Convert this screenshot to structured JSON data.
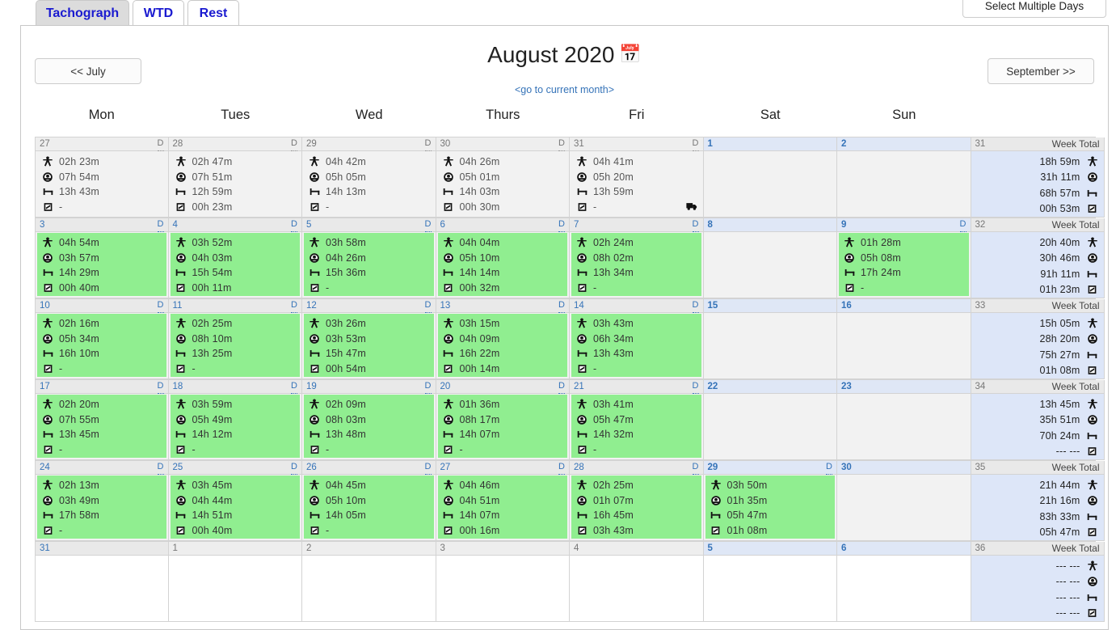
{
  "tabs": [
    {
      "label": "Tachograph",
      "active": true
    },
    {
      "label": "WTD",
      "active": false
    },
    {
      "label": "Rest",
      "active": false
    }
  ],
  "toolbar": {
    "select_multiple_days_label": "Select Multiple Days"
  },
  "header": {
    "month_title": "August 2020",
    "calendar_glyph": "📅",
    "prev_month_label": "<< July",
    "next_month_label": "September >>",
    "current_month_link": "<go to current month>"
  },
  "calendar": {
    "day_headers": [
      "Mon",
      "Tues",
      "Wed",
      "Thurs",
      "Fri",
      "Sat",
      "Sun"
    ],
    "week_total_header": "Week Total",
    "day_flag_label": "D",
    "empty_value": "-",
    "no_value": "--- ---",
    "metric_icons": [
      "work-icon",
      "drive-icon",
      "rest-icon",
      "poa-icon"
    ],
    "colors": {
      "green_day": "#90ee90",
      "weekend_header": "#dfe7f6",
      "week_total_body": "#dde6f8",
      "link": "#3573b8",
      "tab_text": "#1a1ad0"
    },
    "weeks": [
      {
        "week_number": "31",
        "days": [
          {
            "num": "27",
            "type": "outmonth",
            "flag": "D",
            "values": [
              "02h 23m",
              "07h 54m",
              "13h 43m",
              "-"
            ],
            "green": false
          },
          {
            "num": "28",
            "type": "outmonth",
            "flag": "D",
            "values": [
              "02h 47m",
              "07h 51m",
              "12h 59m",
              "00h 23m"
            ],
            "green": false
          },
          {
            "num": "29",
            "type": "outmonth",
            "flag": "D",
            "values": [
              "04h 42m",
              "05h 05m",
              "14h 13m",
              "-"
            ],
            "green": false
          },
          {
            "num": "30",
            "type": "outmonth",
            "flag": "D",
            "values": [
              "04h 26m",
              "05h 01m",
              "14h 03m",
              "00h 30m"
            ],
            "green": false
          },
          {
            "num": "31",
            "type": "outmonth",
            "flag": "D",
            "values": [
              "04h 41m",
              "05h 20m",
              "13h 59m",
              "-"
            ],
            "green": false,
            "truck": true
          },
          {
            "num": "1",
            "type": "weekend",
            "flag": "",
            "values": [],
            "green": false
          },
          {
            "num": "2",
            "type": "weekend",
            "flag": "",
            "values": [],
            "green": false
          }
        ],
        "totals": [
          "18h 59m",
          "31h 11m",
          "68h 57m",
          "00h 53m"
        ]
      },
      {
        "week_number": "32",
        "days": [
          {
            "num": "3",
            "type": "inmonth",
            "flag": "D",
            "values": [
              "04h 54m",
              "03h 57m",
              "14h 29m",
              "00h 40m"
            ],
            "green": true
          },
          {
            "num": "4",
            "type": "inmonth",
            "flag": "D",
            "values": [
              "03h 52m",
              "04h 03m",
              "15h 54m",
              "00h 11m"
            ],
            "green": true
          },
          {
            "num": "5",
            "type": "inmonth",
            "flag": "D",
            "values": [
              "03h 58m",
              "04h 26m",
              "15h 36m",
              "-"
            ],
            "green": true
          },
          {
            "num": "6",
            "type": "inmonth",
            "flag": "D",
            "values": [
              "04h 04m",
              "05h 10m",
              "14h 14m",
              "00h 32m"
            ],
            "green": true
          },
          {
            "num": "7",
            "type": "inmonth",
            "flag": "D",
            "values": [
              "02h 24m",
              "08h 02m",
              "13h 34m",
              "-"
            ],
            "green": true
          },
          {
            "num": "8",
            "type": "weekend",
            "flag": "",
            "values": [],
            "green": false
          },
          {
            "num": "9",
            "type": "weekend",
            "flag": "D",
            "values": [
              "01h 28m",
              "05h 08m",
              "17h 24m",
              "-"
            ],
            "green": true
          }
        ],
        "totals": [
          "20h 40m",
          "30h 46m",
          "91h 11m",
          "01h 23m"
        ]
      },
      {
        "week_number": "33",
        "days": [
          {
            "num": "10",
            "type": "inmonth",
            "flag": "D",
            "values": [
              "02h 16m",
              "05h 34m",
              "16h 10m",
              "-"
            ],
            "green": true
          },
          {
            "num": "11",
            "type": "inmonth",
            "flag": "D",
            "values": [
              "02h 25m",
              "08h 10m",
              "13h 25m",
              "-"
            ],
            "green": true
          },
          {
            "num": "12",
            "type": "inmonth",
            "flag": "D",
            "values": [
              "03h 26m",
              "03h 53m",
              "15h 47m",
              "00h 54m"
            ],
            "green": true
          },
          {
            "num": "13",
            "type": "inmonth",
            "flag": "D",
            "values": [
              "03h 15m",
              "04h 09m",
              "16h 22m",
              "00h 14m"
            ],
            "green": true
          },
          {
            "num": "14",
            "type": "inmonth",
            "flag": "D",
            "values": [
              "03h 43m",
              "06h 34m",
              "13h 43m",
              "-"
            ],
            "green": true
          },
          {
            "num": "15",
            "type": "weekend",
            "flag": "",
            "values": [],
            "green": false
          },
          {
            "num": "16",
            "type": "weekend",
            "flag": "",
            "values": [],
            "green": false
          }
        ],
        "totals": [
          "15h 05m",
          "28h 20m",
          "75h 27m",
          "01h 08m"
        ]
      },
      {
        "week_number": "34",
        "days": [
          {
            "num": "17",
            "type": "inmonth",
            "flag": "D",
            "values": [
              "02h 20m",
              "07h 55m",
              "13h 45m",
              "-"
            ],
            "green": true
          },
          {
            "num": "18",
            "type": "inmonth",
            "flag": "D",
            "values": [
              "03h 59m",
              "05h 49m",
              "14h 12m",
              "-"
            ],
            "green": true
          },
          {
            "num": "19",
            "type": "inmonth",
            "flag": "D",
            "values": [
              "02h 09m",
              "08h 03m",
              "13h 48m",
              "-"
            ],
            "green": true
          },
          {
            "num": "20",
            "type": "inmonth",
            "flag": "D",
            "values": [
              "01h 36m",
              "08h 17m",
              "14h 07m",
              "-"
            ],
            "green": true
          },
          {
            "num": "21",
            "type": "inmonth",
            "flag": "D",
            "values": [
              "03h 41m",
              "05h 47m",
              "14h 32m",
              "-"
            ],
            "green": true
          },
          {
            "num": "22",
            "type": "weekend",
            "flag": "",
            "values": [],
            "green": false
          },
          {
            "num": "23",
            "type": "weekend",
            "flag": "",
            "values": [],
            "green": false
          }
        ],
        "totals": [
          "13h 45m",
          "35h 51m",
          "70h 24m",
          "--- ---"
        ]
      },
      {
        "week_number": "35",
        "days": [
          {
            "num": "24",
            "type": "inmonth",
            "flag": "D",
            "values": [
              "02h 13m",
              "03h 49m",
              "17h 58m",
              "-"
            ],
            "green": true
          },
          {
            "num": "25",
            "type": "inmonth",
            "flag": "D",
            "values": [
              "03h 45m",
              "04h 44m",
              "14h 51m",
              "00h 40m"
            ],
            "green": true
          },
          {
            "num": "26",
            "type": "inmonth",
            "flag": "D",
            "values": [
              "04h 45m",
              "05h 10m",
              "14h 05m",
              "-"
            ],
            "green": true
          },
          {
            "num": "27",
            "type": "inmonth",
            "flag": "D",
            "values": [
              "04h 46m",
              "04h 51m",
              "14h 07m",
              "00h 16m"
            ],
            "green": true
          },
          {
            "num": "28",
            "type": "inmonth",
            "flag": "D",
            "values": [
              "02h 25m",
              "01h 07m",
              "16h 45m",
              "03h 43m"
            ],
            "green": true
          },
          {
            "num": "29",
            "type": "weekend",
            "flag": "D",
            "values": [
              "03h 50m",
              "01h 35m",
              "05h 47m",
              "01h 08m"
            ],
            "green": true
          },
          {
            "num": "30",
            "type": "weekend",
            "flag": "",
            "values": [],
            "green": false
          }
        ],
        "totals": [
          "21h 44m",
          "21h 16m",
          "83h 33m",
          "05h 47m"
        ]
      },
      {
        "week_number": "36",
        "days": [
          {
            "num": "31",
            "type": "inmonth-empty",
            "flag": "",
            "values": [],
            "green": false
          },
          {
            "num": "1",
            "type": "outmonth-empty",
            "flag": "",
            "values": [],
            "green": false
          },
          {
            "num": "2",
            "type": "outmonth-empty",
            "flag": "",
            "values": [],
            "green": false
          },
          {
            "num": "3",
            "type": "outmonth-empty",
            "flag": "",
            "values": [],
            "green": false
          },
          {
            "num": "4",
            "type": "outmonth-empty",
            "flag": "",
            "values": [],
            "green": false
          },
          {
            "num": "5",
            "type": "weekend-empty",
            "flag": "",
            "values": [],
            "green": false
          },
          {
            "num": "6",
            "type": "weekend-empty",
            "flag": "",
            "values": [],
            "green": false
          }
        ],
        "totals": [
          "--- ---",
          "--- ---",
          "--- ---",
          "--- ---"
        ]
      }
    ]
  }
}
